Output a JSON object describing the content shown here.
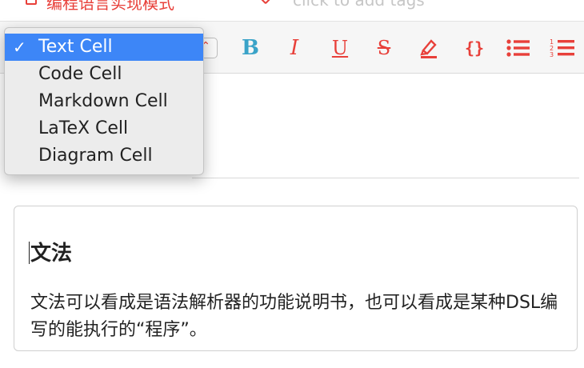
{
  "notebook": {
    "title": "编程语言实现模式",
    "tags_placeholder": "click to add tags"
  },
  "toolbar": {
    "cell_type_selected": "Text Cell",
    "buttons": {
      "bold": "B",
      "italic": "I",
      "underline": "U",
      "strikethrough": "S",
      "code": "{}"
    }
  },
  "dropdown": {
    "items": [
      {
        "label": "Text Cell",
        "selected": true
      },
      {
        "label": "Code Cell",
        "selected": false
      },
      {
        "label": "Markdown Cell",
        "selected": false
      },
      {
        "label": "LaTeX Cell",
        "selected": false
      },
      {
        "label": "Diagram Cell",
        "selected": false
      }
    ],
    "check_mark": "✓"
  },
  "cell": {
    "heading": "文法",
    "body": "文法可以看成是语法解析器的功能说明书，也可以看成是某种DSL编写的能执行的“程序”。"
  },
  "colors": {
    "accent": "#e8403a",
    "bold_icon": "#3aa3c8",
    "menu_selected": "#3d86f7"
  },
  "icons": {
    "notebook": "notebook-icon",
    "tag": "tag-icon",
    "highlight": "highlighter-icon",
    "bulleted_list": "bulleted-list-icon",
    "numbered_list": "numbered-list-icon",
    "select_chevron": "updown-chevron-icon"
  }
}
